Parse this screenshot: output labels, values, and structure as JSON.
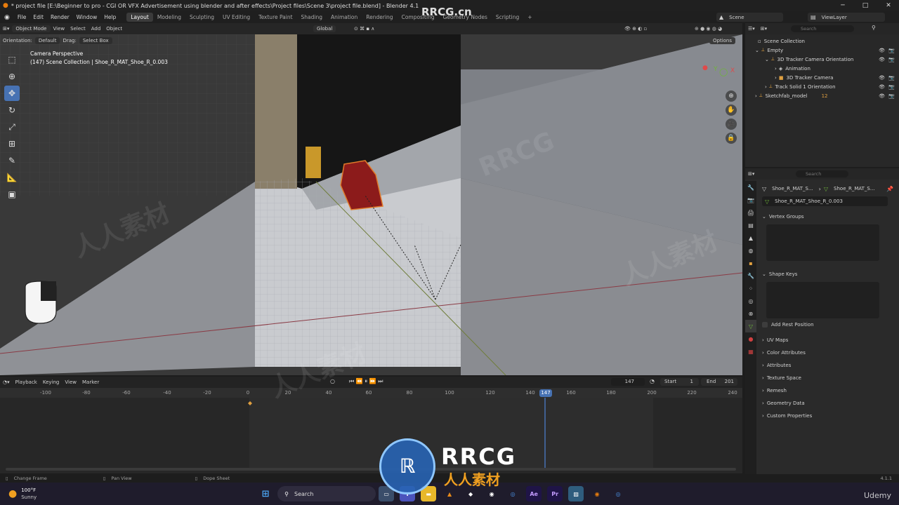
{
  "window": {
    "title": "* project file [E:\\Beginner to pro - CGI OR VFX Advertisement using blender and after effects\\Project files\\Scene 3\\project file.blend] - Blender 4.1",
    "minimize": "─",
    "maximize": "□",
    "close": "✕"
  },
  "menu": {
    "items": [
      "File",
      "Edit",
      "Render",
      "Window",
      "Help"
    ]
  },
  "workspaces": [
    "Layout",
    "Modeling",
    "Sculpting",
    "UV Editing",
    "Texture Paint",
    "Shading",
    "Animation",
    "Rendering",
    "Compositing",
    "Geometry Nodes",
    "Scripting",
    "+"
  ],
  "topright": {
    "scene": "Scene",
    "viewlayer": "ViewLayer"
  },
  "viewport": {
    "mode": "Object Mode",
    "menus": [
      "View",
      "Select",
      "Add",
      "Object"
    ],
    "orientation_label": "Orientation:",
    "orientation": "Default",
    "drag_label": "Drag:",
    "drag": "Select Box",
    "transform": "Global",
    "options": "Options",
    "camera_label": "Camera Perspective",
    "collection_label": "(147) Scene Collection | Shoe_R_MAT_Shoe_R_0.003"
  },
  "outliner": {
    "search_placeholder": "Search",
    "rows": [
      {
        "label": "Scene Collection"
      },
      {
        "label": "Empty"
      },
      {
        "label": "3D Tracker Camera Orientation"
      },
      {
        "label": "Animation"
      },
      {
        "label": "3D Tracker Camera"
      },
      {
        "label": "Track Solid 1 Orientation"
      },
      {
        "label": "Sketchfab_model",
        "badge": "12"
      }
    ]
  },
  "properties": {
    "search_placeholder": "Search",
    "breadcrumb_a": "Shoe_R_MAT_S...",
    "breadcrumb_b": "Shoe_R_MAT_S...",
    "datablock": "Shoe_R_MAT_Shoe_R_0.003",
    "panels": {
      "vertex_groups": "Vertex Groups",
      "shape_keys": "Shape Keys",
      "add_rest": "Add Rest Position",
      "uv_maps": "UV Maps",
      "color_attributes": "Color Attributes",
      "attributes": "Attributes",
      "texture_space": "Texture Space",
      "remesh": "Remesh",
      "geometry_data": "Geometry Data",
      "custom_properties": "Custom Properties"
    }
  },
  "timeline": {
    "menus": [
      "Playback",
      "Keying",
      "View",
      "Marker"
    ],
    "current_frame": "147",
    "start_label": "Start",
    "start": "1",
    "end_label": "End",
    "end": "201",
    "ticks": [
      "-100",
      "-80",
      "-60",
      "-40",
      "-20",
      "0",
      "20",
      "40",
      "60",
      "80",
      "100",
      "120",
      "140",
      "160",
      "180",
      "200",
      "220",
      "240"
    ],
    "playhead": "147"
  },
  "status": {
    "change_frame": "Change Frame",
    "pan_view": "Pan View",
    "dope_sheet": "Dope Sheet",
    "version": "4.1.1"
  },
  "taskbar": {
    "temp": "100°F",
    "weather": "Sunny",
    "search": "Search"
  },
  "watermark": {
    "top": "RRCG.cn",
    "brand": "RRCG",
    "brand_cn": "人人素材",
    "site": "Udemy",
    "scatter_cn": "人人素材",
    "scatter_en": "RRCG"
  }
}
